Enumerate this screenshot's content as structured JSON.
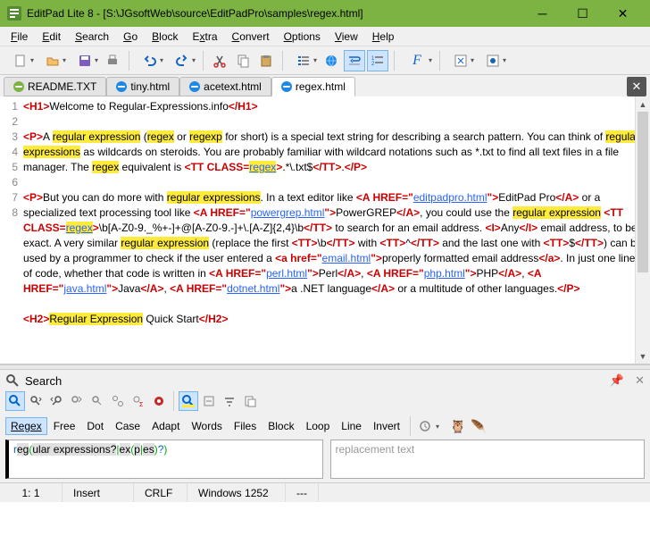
{
  "window": {
    "title": "EditPad Lite 8 - [S:\\JGsoftWeb\\source\\EditPadPro\\samples\\regex.html]"
  },
  "menu": {
    "file": "File",
    "edit": "Edit",
    "search": "Search",
    "go": "Go",
    "block": "Block",
    "extra": "Extra",
    "convert": "Convert",
    "options": "Options",
    "view": "View",
    "help": "Help"
  },
  "tabs": [
    {
      "label": "README.TXT"
    },
    {
      "label": "tiny.html"
    },
    {
      "label": "acetext.html"
    },
    {
      "label": "regex.html"
    }
  ],
  "activeTab": 3,
  "lines": [
    "1",
    "2",
    "3",
    "",
    "",
    "4",
    "5",
    "",
    "",
    "",
    "",
    "",
    "",
    "",
    "6",
    "7",
    "8"
  ],
  "content": {
    "l1_h1o": "<H1>",
    "l1_txt": "Welcome to Regular-Expressions.info",
    "l1_h1c": "</H1>",
    "l3_po": "<P>",
    "l3_a": "A ",
    "l3_re": "regular expression",
    "l3_paren": " (",
    "l3_regex": "regex",
    "l3_or": " or ",
    "l3_regexp": "regexp",
    "l3_rest": " for short) is a special text string for describing a search pattern.  You can think of ",
    "l3_res": "regular expressions",
    "l3_rest2": " as wildcards on steroids.  You are probably familiar with wildcard notations such as *.txt to find all text files in a file manager.  The ",
    "l3_regex2": "regex",
    "l3_eq": " equivalent is ",
    "l3_tto": "<TT CLASS=",
    "l3_cls": "regex",
    "l3_ttc": ">",
    "l3_val": ".*\\.txt$",
    "l3_tte": "</TT>",
    "l3_dot": ".",
    "l3_pc": "</P>",
    "l5_po": "<P>",
    "l5_a": "But you can do more with ",
    "l5_res": "regular expressions",
    "l5_b": ".  In a text editor like ",
    "l5_ao1": "<A HREF=\"",
    "l5_h1": "editpadpro.html",
    "l5_ac1": "\">",
    "l5_t1": "EditPad Pro",
    "l5_ae": "</A>",
    "l5_c": " or a specialized text processing tool like ",
    "l5_h2": "powergrep.html",
    "l5_t2": "PowerGREP",
    "l5_d": ", you could use the ",
    "l5_re": "regular expression",
    "l5_sp": " ",
    "l5_tto": "<TT CLASS=",
    "l5_cls": "regex",
    "l5_ttc": ">",
    "l5_rx": "\\b[A-Z0-9._%+-]+@[A-Z0-9.-]+\\.[A-Z]{2,4}\\b",
    "l5_tte": "</TT>",
    "l5_e": " to search for an email address.  ",
    "l5_io": "<I>",
    "l5_any": "Any",
    "l5_ic": "</I>",
    "l5_f": " email address, to be exact.  A very similar ",
    "l5_re2": "regular expression",
    "l5_g": " (replace the first ",
    "l5_tto2": "<TT>",
    "l5_bv": "\\b",
    "l5_tte2": "</TT>",
    "l5_h": " with ",
    "l5_cv": "^",
    "l5_i": " and the last one with ",
    "l5_dv": "$",
    "l5_j": ") can be used by a programmer to check if the user entered a ",
    "l5_ao2": "<a href=\"",
    "l5_h3": "email.html",
    "l5_ac2": "\">",
    "l5_t3": "properly formatted email address",
    "l5_ae2": "</a>",
    "l5_k": ".  In just one line of code, whether that code is written in ",
    "l5_h4": "perl.html",
    "l5_t4": "Perl",
    "l5_comma": ", ",
    "l5_h5": "php.html",
    "l5_t5": "PHP",
    "l5_h6": "java.html",
    "l5_t6": "Java",
    "l5_h7": "dotnet.html",
    "l5_t7": "a .NET language",
    "l5_l": " or a multitude of other languages.",
    "l5_pc": "</P>",
    "l7_h2o": "<H2>",
    "l7_re": "Regular Expression",
    "l7_txt": " Quick Start",
    "l7_h2c": "</H2>"
  },
  "search": {
    "header": "Search",
    "options": [
      "Regex",
      "Free",
      "Dot",
      "Case",
      "Adapt",
      "Words",
      "Files",
      "Block",
      "Loop",
      "Line",
      "Invert"
    ],
    "regex_parts": {
      "p1": "r",
      "p2": "eg",
      "p3": "(",
      "p4": "ular expressions?",
      "p5": "|",
      "p6": "ex",
      "p7": "(",
      "p8": "p",
      "p9": "|",
      "p10": "es",
      "p11": ")",
      "p12": "?",
      "p13": ")"
    },
    "replace_placeholder": "replacement text"
  },
  "status": {
    "pos": "1: 1",
    "mode": "Insert",
    "eol": "CRLF",
    "enc": "Windows 1252",
    "extra": "---"
  }
}
